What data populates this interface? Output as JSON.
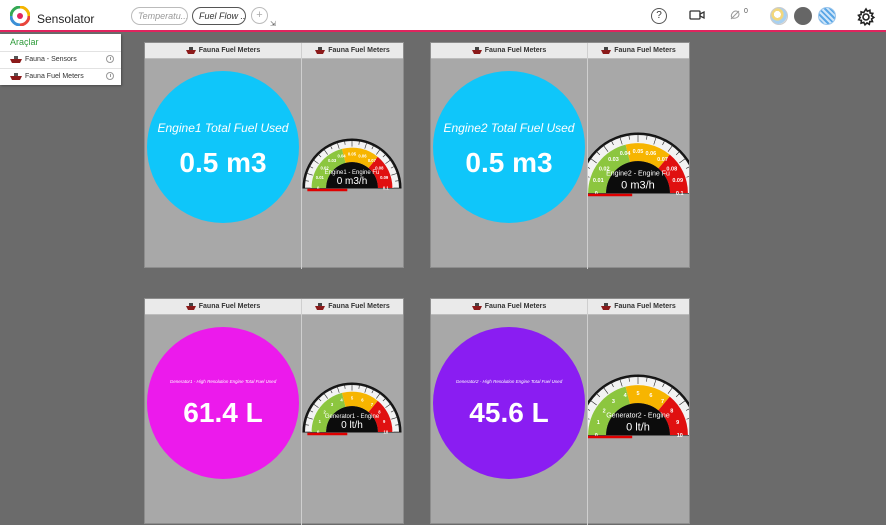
{
  "app": {
    "title": "Sensolator",
    "logo": "sensolator-logo"
  },
  "tabs": [
    {
      "label": "Temperatu..."
    },
    {
      "label": "Fuel Flow ..."
    }
  ],
  "toolbar": {
    "help_label": "?",
    "notification_count": "0",
    "icons": [
      "help-icon",
      "camera-icon",
      "bell-icon",
      "theme-icon",
      "gear-icon"
    ]
  },
  "tool_panel": {
    "title": "Araçlar",
    "items": [
      {
        "label": "Fauna - Sensors"
      },
      {
        "label": "Fauna Fuel Meters"
      }
    ]
  },
  "colors": {
    "accent": "#e0245e",
    "cyan": "#0fc6fa",
    "magenta": "#ec1aec",
    "violet": "#8a1df2",
    "panel_title": "#2e9b3a"
  },
  "widgets": [
    {
      "header": "Fauna Fuel Meters",
      "total_title": "Engine1 Total Fuel Used",
      "total_value": "0.5 m3",
      "circle_color": "#0fc6fa",
      "gauge": {
        "name": "Engine1 - Engine Fu",
        "readout": "0 m3/h",
        "min": 0,
        "max": 0.1,
        "value": 0,
        "ticks": [
          "0",
          "0.01",
          "0.02",
          "0.03",
          "0.04",
          "0.05",
          "0.06",
          "0.07",
          "0.08",
          "0.09",
          "0.1"
        ]
      }
    },
    {
      "header": "Fauna Fuel Meters",
      "total_title": "Engine2 Total Fuel Used",
      "total_value": "0.5 m3",
      "circle_color": "#0fc6fa",
      "gauge": {
        "name": "Engine2 - Engine Fu",
        "readout": "0 m3/h",
        "min": 0,
        "max": 0.1,
        "value": 0,
        "ticks": [
          "0",
          "0.01",
          "0.02",
          "0.03",
          "0.04",
          "0.05",
          "0.06",
          "0.07",
          "0.08",
          "0.09",
          "0.1"
        ]
      }
    },
    {
      "header": "Fauna Fuel Meters",
      "total_title": "Generator1 - High Resolution Engine Total Fuel Used",
      "total_value": "61.4 L",
      "circle_color": "#ec1aec",
      "gauge": {
        "name": "Generator1 - Engine",
        "readout": "0 lt/h",
        "min": 0,
        "max": 10,
        "value": 0,
        "ticks": [
          "0",
          "1",
          "2",
          "3",
          "4",
          "5",
          "6",
          "7",
          "8",
          "9",
          "10"
        ]
      }
    },
    {
      "header": "Fauna Fuel Meters",
      "total_title": "Generator2 - High Resolution Engine Total Fuel Used",
      "total_value": "45.6 L",
      "circle_color": "#8a1df2",
      "gauge": {
        "name": "Generator2 - Engine",
        "readout": "0 lt/h",
        "min": 0,
        "max": 10,
        "value": 0,
        "ticks": [
          "0",
          "1",
          "2",
          "3",
          "4",
          "5",
          "6",
          "7",
          "8",
          "9",
          "10"
        ]
      }
    }
  ]
}
